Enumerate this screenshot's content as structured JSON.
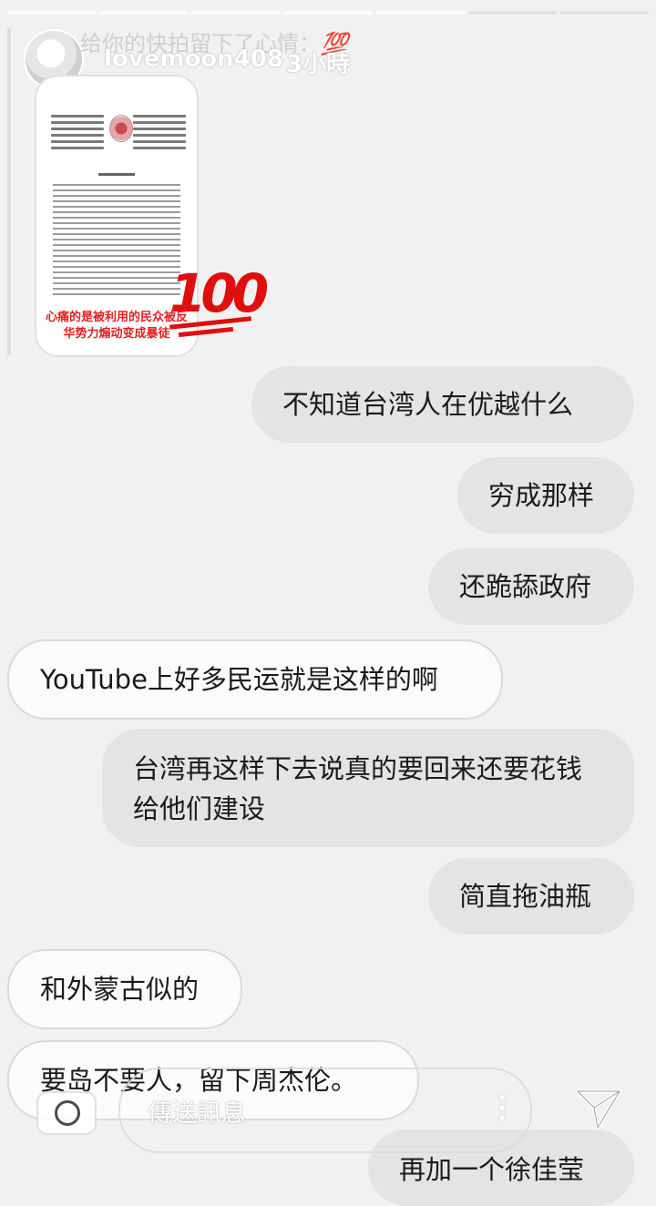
{
  "story": {
    "progress_segments": [
      1,
      1,
      1,
      1,
      1,
      0,
      0
    ],
    "reply_note": "给你的快拍留下了心情：",
    "reply_emoji": "💯",
    "username": "lovemoon408",
    "time_ago": "3小時",
    "shared_post": {
      "caption": "心痛的是被利用的民众被反华势力煽动变成暴徒",
      "badge": "100"
    }
  },
  "messages": [
    {
      "side": "out",
      "text": "不知道台湾人在优越什么"
    },
    {
      "side": "out",
      "text": "穷成那样"
    },
    {
      "side": "out",
      "text": "还跪舔政府"
    },
    {
      "side": "in",
      "text": "YouTube上好多民运就是这样的啊"
    },
    {
      "side": "out",
      "text": "台湾再这样下去说真的要回来还要花钱给他们建设"
    },
    {
      "side": "out",
      "text": "简直拖油瓶"
    },
    {
      "side": "in",
      "text": "和外蒙古似的"
    },
    {
      "side": "in",
      "text": "要岛不要人，留下周杰伦。"
    },
    {
      "side": "out",
      "text": "再加一个徐佳莹"
    }
  ],
  "composer": {
    "placeholder": "傳送訊息",
    "camera_icon": "camera-icon",
    "more_icon": "more-vertical-icon",
    "send_icon": "send-paper-plane-icon"
  }
}
